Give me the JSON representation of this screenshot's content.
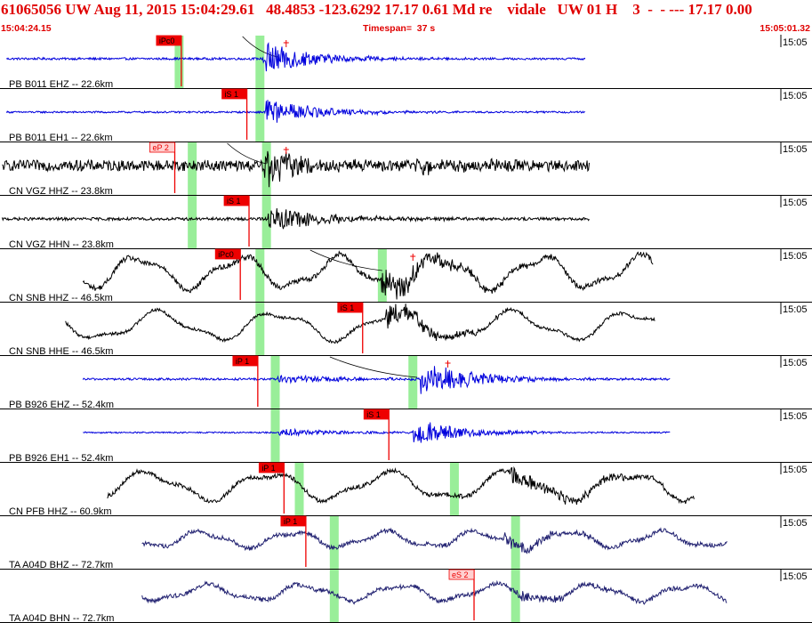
{
  "header": {
    "title": "61065056 UW Aug 11, 2015 15:04:29.61   48.4853 -123.6292 17.17 0.61 Md re    vidale   UW 01 H    3  -  - --- 17.17 0.00",
    "start_time": "15:04:24.15",
    "timespan": "Timespan=  37 s",
    "end_time": "15:05:01.32"
  },
  "chart_data": {
    "type": "line",
    "time_range_s": [
      0,
      37.17
    ],
    "time_tick_label": "15:05",
    "colors": {
      "blue": "#0000dd",
      "black": "#000000",
      "navy": "#202070",
      "pick": "#ee0000",
      "window": "#99ee99",
      "header": "#e00000"
    },
    "traces": [
      {
        "label": "PB B011 EHZ -- 22.6km",
        "color": "blue",
        "start": 0.3,
        "end": 26.8,
        "amp": 0.06,
        "lp": 0,
        "burst_t": 12.2,
        "burst_amp": 0.9,
        "burst_decay": 2.2,
        "picks": [
          {
            "label": "iPc0",
            "t": 8.3
          }
        ],
        "windows": [
          8.2,
          11.9
        ],
        "theory_curve": [
          11.1,
          12.7
        ],
        "theory_mark": 13.1
      },
      {
        "label": "PB B011 EH1 -- 22.6km",
        "color": "blue",
        "start": 0.3,
        "end": 26.8,
        "amp": 0.05,
        "lp": 0,
        "burst_t": 12.3,
        "burst_amp": 0.7,
        "burst_decay": 2.4,
        "picks": [
          {
            "label": "iS 1",
            "t": 11.3
          }
        ],
        "windows": [
          11.9
        ]
      },
      {
        "label": "CN VGZ HHZ -- 23.8km",
        "color": "black",
        "start": 0.1,
        "end": 27.0,
        "amp": 0.3,
        "lp": 0,
        "burst_t": 12.2,
        "burst_amp": 1.1,
        "burst_decay": 1.6,
        "burst2_t": 19.0,
        "burst2_amp": 0.4,
        "picks": [
          {
            "label": "eP 2",
            "t": 8.0
          }
        ],
        "windows": [
          8.8,
          12.2
        ],
        "theory_curve": [
          10.4,
          12.2
        ],
        "theory_mark": 13.1
      },
      {
        "label": "CN VGZ HHN -- 23.8km",
        "color": "black",
        "start": 0.1,
        "end": 27.0,
        "amp": 0.08,
        "lp": 0,
        "burst_t": 12.4,
        "burst_amp": 0.7,
        "burst_decay": 2.6,
        "picks": [
          {
            "label": "iS 1",
            "t": 11.4
          }
        ],
        "windows": [
          8.8,
          12.2
        ]
      },
      {
        "label": "CN SNB HHZ -- 46.5km",
        "color": "black",
        "start": 3.8,
        "end": 29.9,
        "amp": 0.15,
        "lp": 0.8,
        "lp_period": 4.6,
        "burst_t": 17.6,
        "burst_amp": 0.8,
        "burst_decay": 2.4,
        "picks": [
          {
            "label": "iPc0",
            "t": 11.0
          }
        ],
        "windows": [
          11.9,
          17.5
        ],
        "theory_curve": [
          14.2,
          17.5
        ],
        "theory_mark": 18.9
      },
      {
        "label": "CN SNB HHE -- 46.5km",
        "color": "black",
        "start": 3.0,
        "end": 30.0,
        "amp": 0.09,
        "lp": 0.7,
        "lp_period": 5.4,
        "burst_t": 17.8,
        "burst_amp": 0.6,
        "burst_decay": 2.4,
        "picks": [
          {
            "label": "iS 1",
            "t": 16.6
          }
        ],
        "windows": [
          11.9
        ]
      },
      {
        "label": "PB B926 EHZ -- 52.4km",
        "color": "blue",
        "start": 3.8,
        "end": 30.7,
        "amp": 0.06,
        "lp": 0,
        "burst_t": 19.4,
        "burst_amp": 0.9,
        "burst_decay": 2.4,
        "burst2_t": 12.8,
        "burst2_amp": 0.25,
        "picks": [
          {
            "label": "iP 1",
            "t": 11.8
          }
        ],
        "windows": [
          12.6,
          18.9
        ],
        "theory_curve": [
          15.1,
          19.1
        ],
        "theory_mark": 20.5
      },
      {
        "label": "PB B926 EH1 -- 52.4km",
        "color": "blue",
        "start": 3.8,
        "end": 30.7,
        "amp": 0.04,
        "lp": 0,
        "burst_t": 19.0,
        "burst_amp": 0.8,
        "burst_decay": 2.0,
        "burst2_t": 12.8,
        "burst2_amp": 0.2,
        "picks": [
          {
            "label": "iS 1",
            "t": 17.8
          }
        ],
        "windows": [
          12.6
        ]
      },
      {
        "label": "CN PFB HHZ -- 60.9km",
        "color": "black",
        "start": 4.9,
        "end": 31.8,
        "amp": 0.12,
        "lp": 0.7,
        "lp_period": 5.5,
        "burst_t": 23.5,
        "burst_amp": 0.45,
        "burst_decay": 3.5,
        "picks": [
          {
            "label": "iP 1",
            "t": 13.0
          }
        ],
        "windows": [
          13.7,
          20.8
        ]
      },
      {
        "label": "TA A04D BHZ -- 72.7km",
        "color": "navy",
        "start": 6.5,
        "end": 33.3,
        "amp": 0.12,
        "lp": 0.4,
        "lp_period": 4.2,
        "burst_t": 23.2,
        "burst_amp": 0.35,
        "burst_decay": 2.5,
        "picks": [
          {
            "label": "iP 1",
            "t": 14.0
          }
        ],
        "windows": [
          15.3,
          23.6
        ]
      },
      {
        "label": "TA A04D BHN -- 72.7km",
        "color": "navy",
        "start": 6.5,
        "end": 33.3,
        "amp": 0.12,
        "lp": 0.4,
        "lp_period": 4.4,
        "burst_t": 23.6,
        "burst_amp": 0.3,
        "burst_decay": 2.5,
        "picks": [
          {
            "label": "eS 2",
            "t": 21.7
          }
        ],
        "windows": [
          15.3,
          23.6
        ]
      }
    ]
  }
}
